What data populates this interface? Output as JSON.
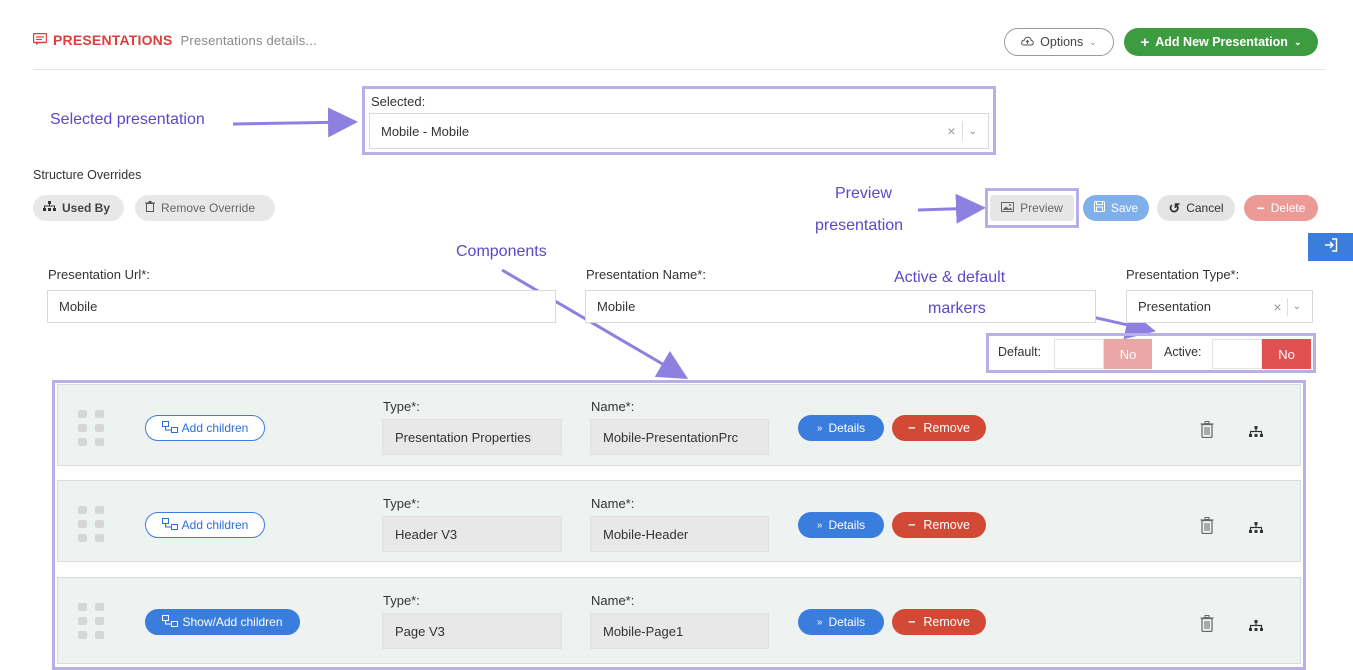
{
  "header": {
    "title": "PRESENTATIONS",
    "subtitle": "Presentations details...",
    "options_label": "Options",
    "add_new_label": "Add New Presentation"
  },
  "annotations": {
    "selected": "Selected presentation",
    "preview_line1": "Preview",
    "preview_line2": "presentation",
    "components": "Components",
    "markers_line1": "Active & default",
    "markers_line2": "markers"
  },
  "selector": {
    "label": "Selected:",
    "value": "Mobile - Mobile"
  },
  "structure": {
    "title": "Structure Overrides",
    "used_by": "Used By",
    "remove_override": "Remove Override"
  },
  "actions": {
    "preview": "Preview",
    "save": "Save",
    "cancel": "Cancel",
    "delete": "Delete"
  },
  "form": {
    "url_label": "Presentation Url*:",
    "url_value": "Mobile",
    "name_label": "Presentation Name*:",
    "name_value": "Mobile",
    "type_label": "Presentation Type*:",
    "type_value": "Presentation",
    "default_label": "Default:",
    "default_value": "No",
    "active_label": "Active:",
    "active_value": "No"
  },
  "components": {
    "type_label": "Type*:",
    "name_label": "Name*:",
    "details_label": "Details",
    "remove_label": "Remove",
    "rows": [
      {
        "children_label": "Add children",
        "type": "Presentation Properties",
        "name": "Mobile-PresentationPrc"
      },
      {
        "children_label": "Add children",
        "type": "Header V3",
        "name": "Mobile-Header"
      },
      {
        "children_label": "Show/Add children",
        "type": "Page V3",
        "name": "Mobile-Page1"
      }
    ]
  },
  "colors": {
    "brand_red": "#d9413f",
    "green": "#3d9c3f",
    "blue": "#3b7ddd",
    "annotation": "#5b48c8",
    "annotation_box": "#b9aee8"
  }
}
